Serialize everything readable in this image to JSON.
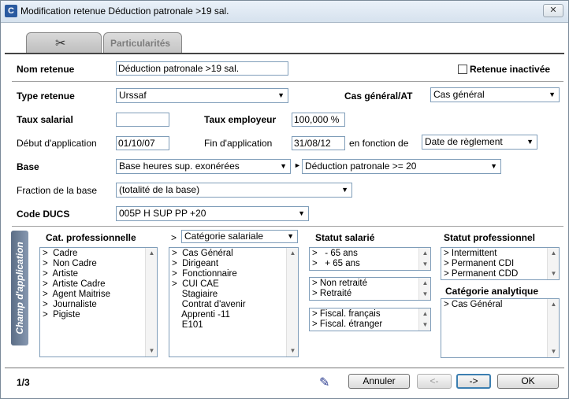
{
  "window": {
    "title": "Modification retenue Déduction patronale >19 sal.",
    "close_label": "✕"
  },
  "tabs": {
    "main_icon": "scissors-icon",
    "particularites": "Particularités"
  },
  "form": {
    "nom_label": "Nom retenue",
    "nom_value": "Déduction patronale >19 sal.",
    "inactive_label": "Retenue inactivée",
    "type_label": "Type retenue",
    "type_value": "Urssaf",
    "cas_label": "Cas général/AT",
    "cas_value": "Cas général",
    "taux_sal_label": "Taux salarial",
    "taux_sal_value": "",
    "taux_emp_label": "Taux employeur",
    "taux_emp_value": "100,000 %",
    "debut_label": "Début d'application",
    "debut_value": "01/10/07",
    "fin_label": "Fin d'application",
    "fin_value": "31/08/12",
    "fonction_label": "en fonction de",
    "fonction_value": "Date de règlement",
    "base_label": "Base",
    "base_value": "Base heures sup. exonérées",
    "base_value2": "Déduction patronale >= 20",
    "fraction_label": "Fraction de la base",
    "fraction_value": "(totalité de la base)",
    "ducs_label": "Code DUCS",
    "ducs_value": "005P   H SUP PP +20"
  },
  "champ": {
    "side_label": "Champ d'application",
    "cat_header": "Cat. professionnelle",
    "cat_items": [
      ">  Cadre",
      ">  Non Cadre",
      ">  Artiste",
      ">  Artiste Cadre",
      ">  Agent Maitrise",
      ">  Journaliste",
      ">  Pigiste"
    ],
    "categorie_prefix": ">",
    "categorie_value": "Catégorie salariale",
    "categorie_items": [
      ">  Cas Général",
      ">  Dirigeant",
      ">  Fonctionnaire",
      ">  CUI CAE",
      "    Stagiaire",
      "    Contrat d'avenir",
      "    Apprenti -11",
      "    E101"
    ],
    "statut_sal_header": "Statut salarié",
    "age_items": [
      ">   - 65 ans",
      ">   + 65 ans"
    ],
    "retraite_items": [
      "> Non retraité",
      "> Retraité"
    ],
    "fiscal_items": [
      "> Fiscal. français",
      "> Fiscal. étranger"
    ],
    "statut_pro_header": "Statut professionnel",
    "statut_pro_items": [
      "> Intermittent",
      "> Permanent CDI",
      "> Permanent CDD"
    ],
    "analytique_header": "Catégorie analytique",
    "analytique_items": [
      "> Cas Général"
    ]
  },
  "footer": {
    "page": "1/3",
    "annuler": "Annuler",
    "prev": "<-",
    "next": "->",
    "ok": "OK"
  }
}
